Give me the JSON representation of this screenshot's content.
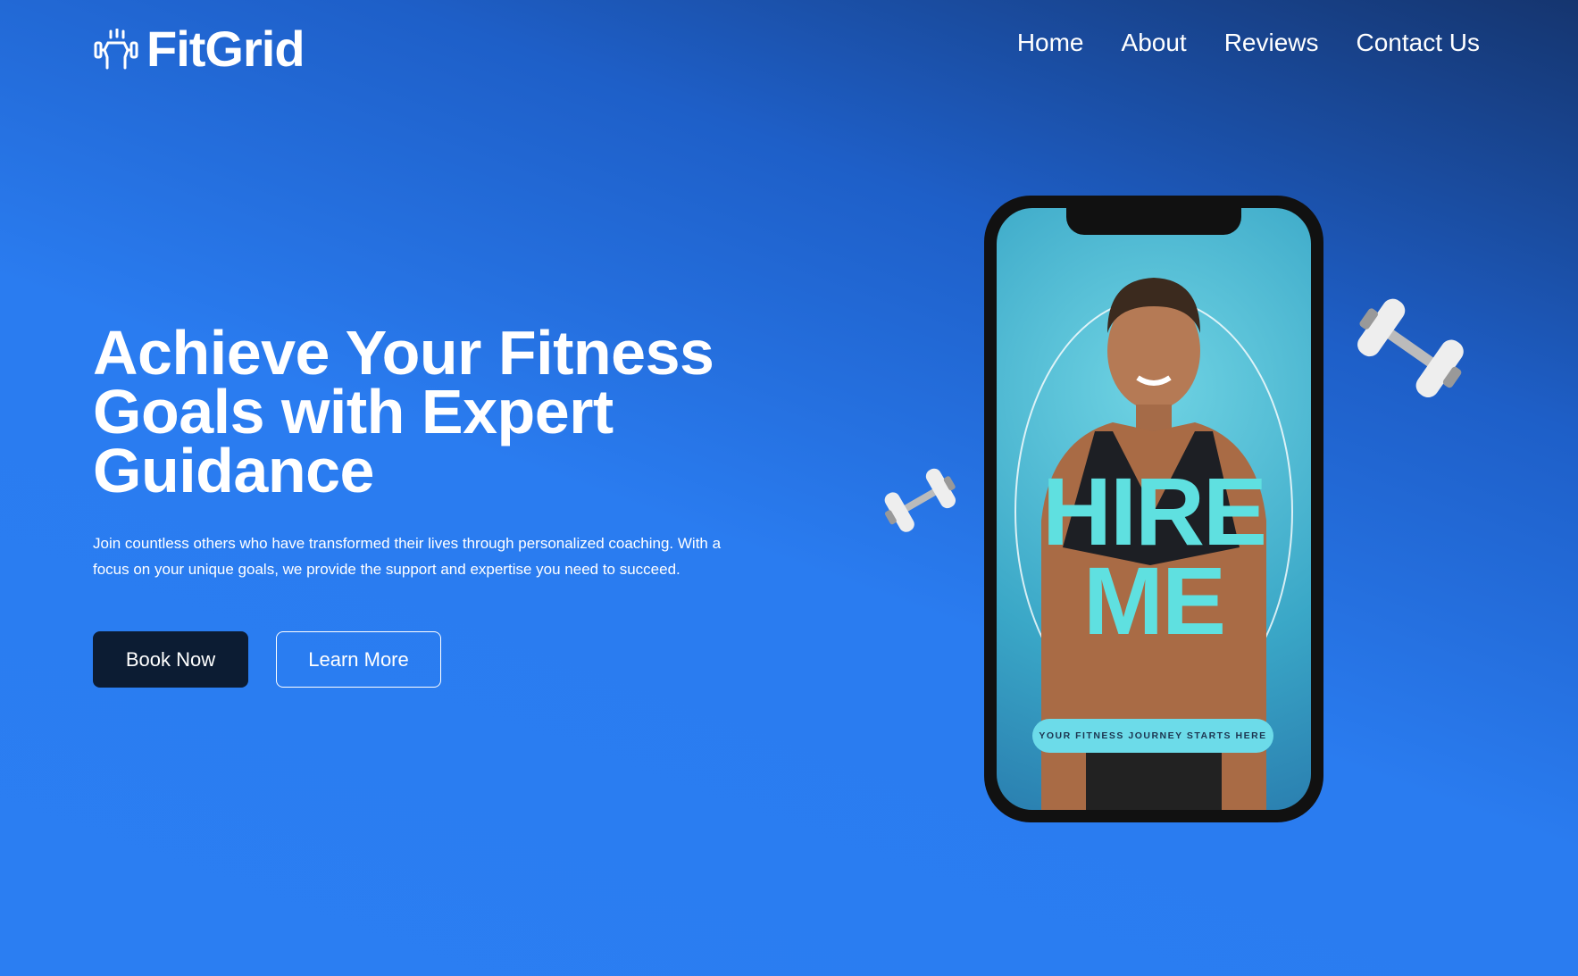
{
  "brand": {
    "name": "FitGrid",
    "logo_icon": "fist-dumbbell-icon"
  },
  "nav": {
    "items": [
      "Home",
      "About",
      "Reviews",
      "Contact Us"
    ]
  },
  "hero": {
    "title": "Achieve Your Fitness Goals with Expert Guidance",
    "description": "Join countless others who have transformed their lives through personalized coaching. With a focus on your unique goals, we provide the support and expertise you need to succeed.",
    "primary_button": "Book Now",
    "secondary_button": "Learn More"
  },
  "phone": {
    "headline": "HIRE ME",
    "tagline": "YOUR FITNESS JOURNEY STARTS HERE"
  },
  "colors": {
    "accent": "#2b7ef2",
    "dark_button": "#0c1c33",
    "cyan": "#5fe0e0"
  }
}
